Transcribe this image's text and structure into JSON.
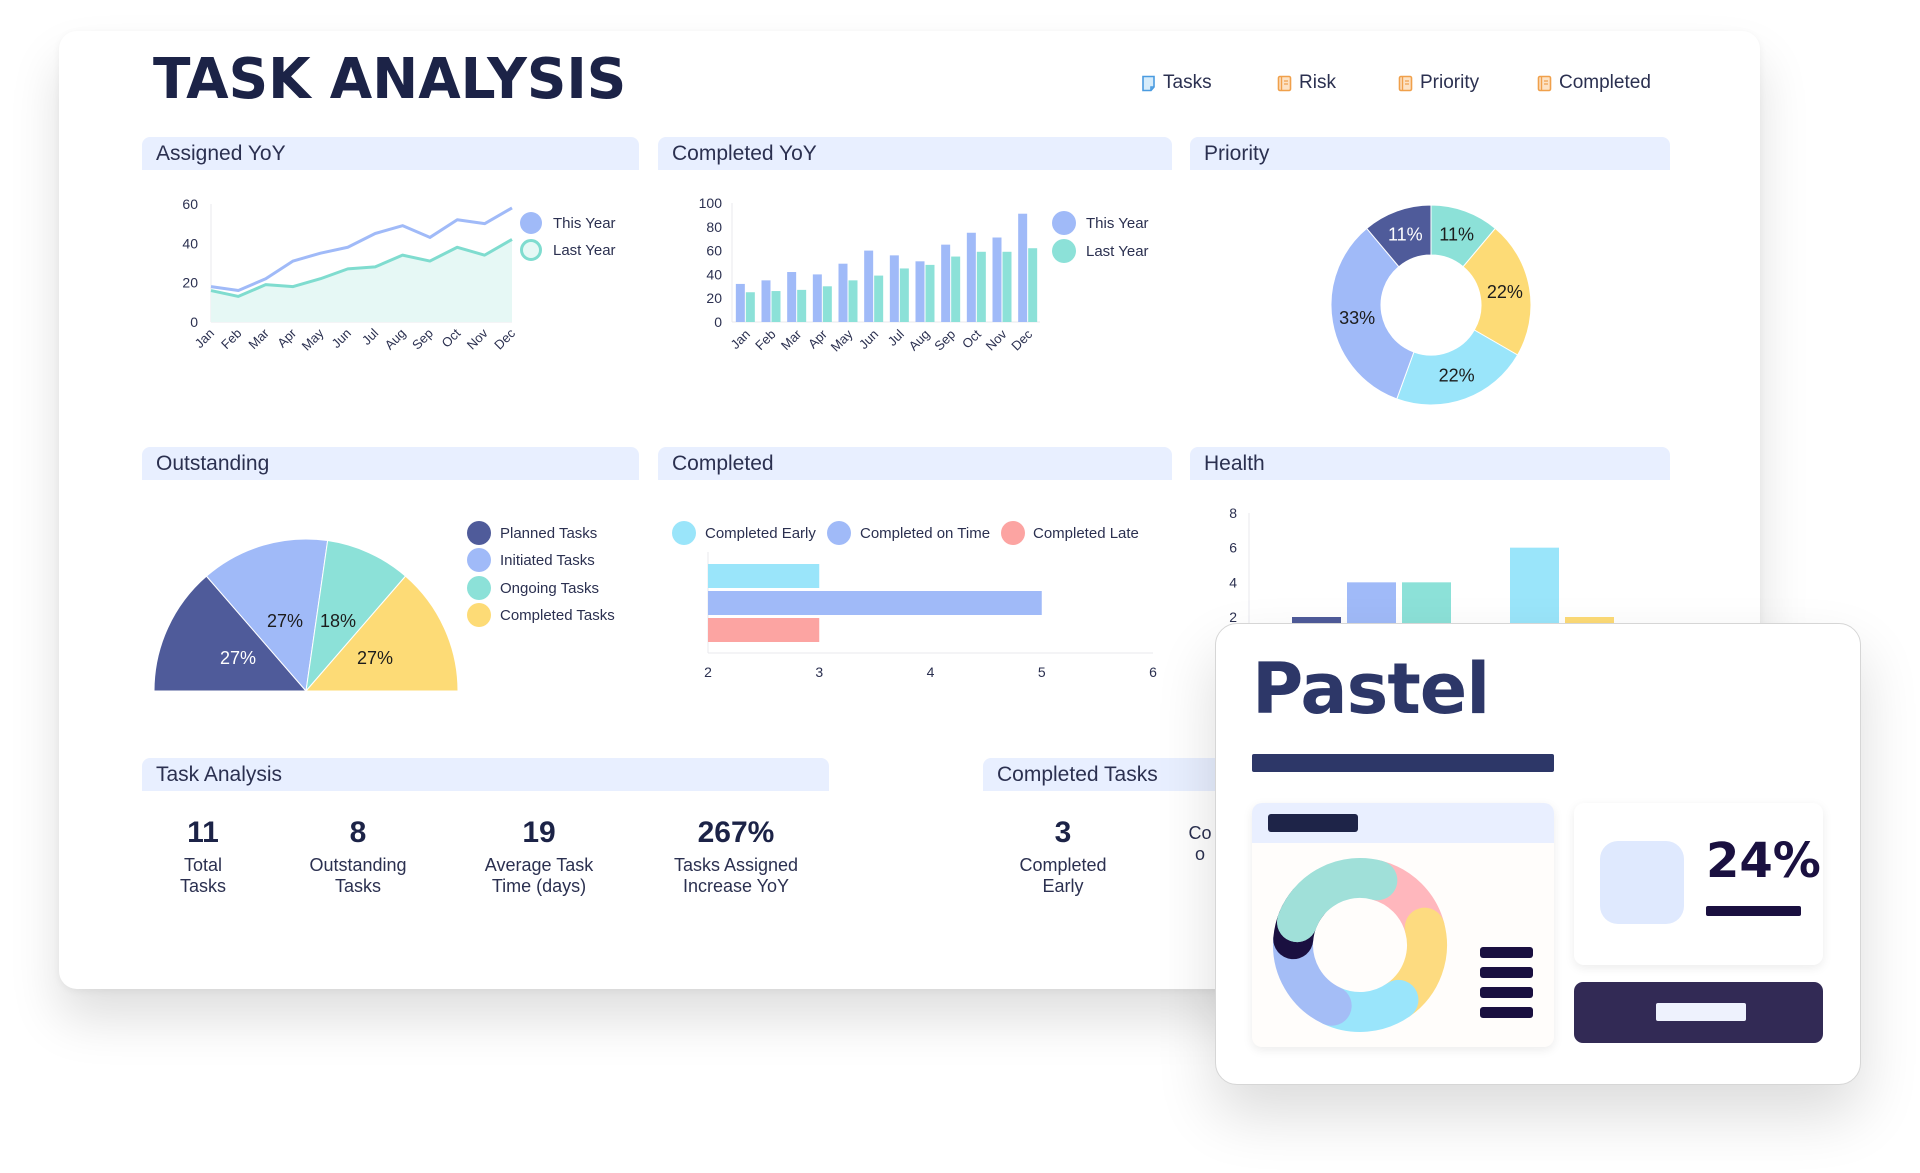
{
  "title": "TASK ANALYSIS",
  "top_legend": [
    {
      "label": "Tasks",
      "icon": "document-icon",
      "color": "#4a9be0"
    },
    {
      "label": "Risk",
      "icon": "notebook-icon",
      "color": "#f0a04b"
    },
    {
      "label": "Priority",
      "icon": "notebook-icon",
      "color": "#f0a04b"
    },
    {
      "label": "Completed",
      "icon": "notebook-icon",
      "color": "#f0a04b"
    }
  ],
  "colors": {
    "navy": "#4f5b9a",
    "periwinkle": "#a0baf8",
    "teal": "#8ce1d8",
    "yellow": "#fddb76",
    "cyan": "#9ae5fa",
    "salmon": "#fca4a2",
    "header_bg": "#e8efff",
    "title": "#1c2347"
  },
  "panels": {
    "assigned_yoy": "Assigned YoY",
    "completed_yoy": "Completed YoY",
    "priority": "Priority",
    "outstanding": "Outstanding",
    "completed": "Completed",
    "health": "Health",
    "task_analysis": "Task Analysis",
    "completed_tasks": "Completed Tasks"
  },
  "chart_data": [
    {
      "id": "assigned_yoy",
      "type": "area",
      "title": "Assigned YoY",
      "categories": [
        "Jan",
        "Feb",
        "Mar",
        "Apr",
        "May",
        "Jun",
        "Jul",
        "Aug",
        "Sep",
        "Oct",
        "Nov",
        "Dec"
      ],
      "series": [
        {
          "name": "This Year",
          "values": [
            18,
            16,
            22,
            31,
            35,
            38,
            45,
            49,
            43,
            52,
            50,
            58
          ],
          "color": "#a0baf8",
          "fill": false
        },
        {
          "name": "Last Year",
          "values": [
            16,
            13,
            19,
            18,
            22,
            27,
            28,
            34,
            31,
            38,
            34,
            42
          ],
          "color": "#7fdccf",
          "fill": true
        }
      ],
      "yticks": [
        0,
        20,
        40,
        60
      ],
      "ylim": [
        0,
        60
      ],
      "legend": "right"
    },
    {
      "id": "completed_yoy",
      "type": "bar",
      "title": "Completed YoY",
      "categories": [
        "Jan",
        "Feb",
        "Mar",
        "Apr",
        "May",
        "Jun",
        "Jul",
        "Aug",
        "Sep",
        "Oct",
        "Nov",
        "Dec"
      ],
      "series": [
        {
          "name": "This Year",
          "values": [
            32,
            35,
            42,
            40,
            49,
            60,
            56,
            51,
            65,
            75,
            71,
            91
          ],
          "color": "#a0baf8"
        },
        {
          "name": "Last Year",
          "values": [
            25,
            26,
            27,
            30,
            35,
            39,
            45,
            48,
            55,
            59,
            59,
            62
          ],
          "color": "#8ce1d8"
        }
      ],
      "yticks": [
        0,
        20,
        40,
        60,
        80,
        100
      ],
      "ylim": [
        0,
        100
      ],
      "legend": "right"
    },
    {
      "id": "priority",
      "type": "pie",
      "title": "Priority",
      "donut": true,
      "slices": [
        {
          "label": "11%",
          "value": 11,
          "color": "#8ce1d8",
          "text_color": "#1c1c1c"
        },
        {
          "label": "22%",
          "value": 22,
          "color": "#fddb76",
          "text_color": "#1c1c1c"
        },
        {
          "label": "22%",
          "value": 22,
          "color": "#9ae5fa",
          "text_color": "#1c1c1c"
        },
        {
          "label": "33%",
          "value": 33,
          "color": "#a0baf8",
          "text_color": "#1c1c1c"
        },
        {
          "label": "11%",
          "value": 11,
          "color": "#4f5b9a",
          "text_color": "#ffffff"
        }
      ]
    },
    {
      "id": "outstanding",
      "type": "pie",
      "title": "Outstanding",
      "half": true,
      "slices": [
        {
          "name": "Planned Tasks",
          "label": "27%",
          "value": 27,
          "color": "#4f5b9a",
          "text_color": "#ffffff"
        },
        {
          "name": "Initiated Tasks",
          "label": "27%",
          "value": 27,
          "color": "#a0baf8",
          "text_color": "#1c1c1c"
        },
        {
          "name": "Ongoing Tasks",
          "label": "18%",
          "value": 18,
          "color": "#8ce1d8",
          "text_color": "#1c1c1c"
        },
        {
          "name": "Completed Tasks",
          "label": "27%",
          "value": 27,
          "color": "#fddb76",
          "text_color": "#1c1c1c"
        }
      ],
      "legend": "right"
    },
    {
      "id": "completed",
      "type": "bar",
      "orientation": "horizontal",
      "title": "Completed",
      "series": [
        {
          "name": "Completed Early",
          "value": 3,
          "color": "#9ae5fa"
        },
        {
          "name": "Completed on Time",
          "value": 5,
          "color": "#a0baf8"
        },
        {
          "name": "Completed Late",
          "value": 3,
          "color": "#fca4a2"
        }
      ],
      "xticks": [
        2,
        3,
        4,
        5,
        6
      ],
      "xlim": [
        2,
        6
      ],
      "legend": "top"
    },
    {
      "id": "health",
      "type": "bar",
      "title": "Health",
      "bars": [
        {
          "value": 2,
          "color": "#4f5b9a"
        },
        {
          "value": 4,
          "color": "#a0baf8"
        },
        {
          "value": 4,
          "color": "#8ce1d8"
        },
        {
          "value": null,
          "color": "#ffffff"
        },
        {
          "value": 6,
          "color": "#9ae5fa"
        },
        {
          "value": 2,
          "color": "#fddb76"
        }
      ],
      "yticks": [
        2,
        4,
        6,
        8
      ],
      "ylim": [
        0,
        8
      ],
      "note": "partially obscured below y=2 by overlay card"
    }
  ],
  "task_analysis_kpis": [
    {
      "value": "11",
      "label_line1": "Total",
      "label_line2": "Tasks"
    },
    {
      "value": "8",
      "label_line1": "Outstanding",
      "label_line2": "Tasks"
    },
    {
      "value": "19",
      "label_line1": "Average Task",
      "label_line2": "Time (days)"
    },
    {
      "value": "267%",
      "label_line1": "Tasks Assigned",
      "label_line2": "Increase YoY"
    }
  ],
  "completed_tasks_kpis": [
    {
      "value": "3",
      "label_line1": "Completed",
      "label_line2": "Early"
    },
    {
      "value": "",
      "label_line1": "Co",
      "label_line2": "o"
    }
  ],
  "overlay": {
    "title": "Pastel",
    "percent": "24%",
    "donut_colors": [
      "#a0e0d9",
      "#ffb7bd",
      "#fddb80",
      "#9ae5fb",
      "#a4bdf6",
      "#1a1040"
    ]
  }
}
